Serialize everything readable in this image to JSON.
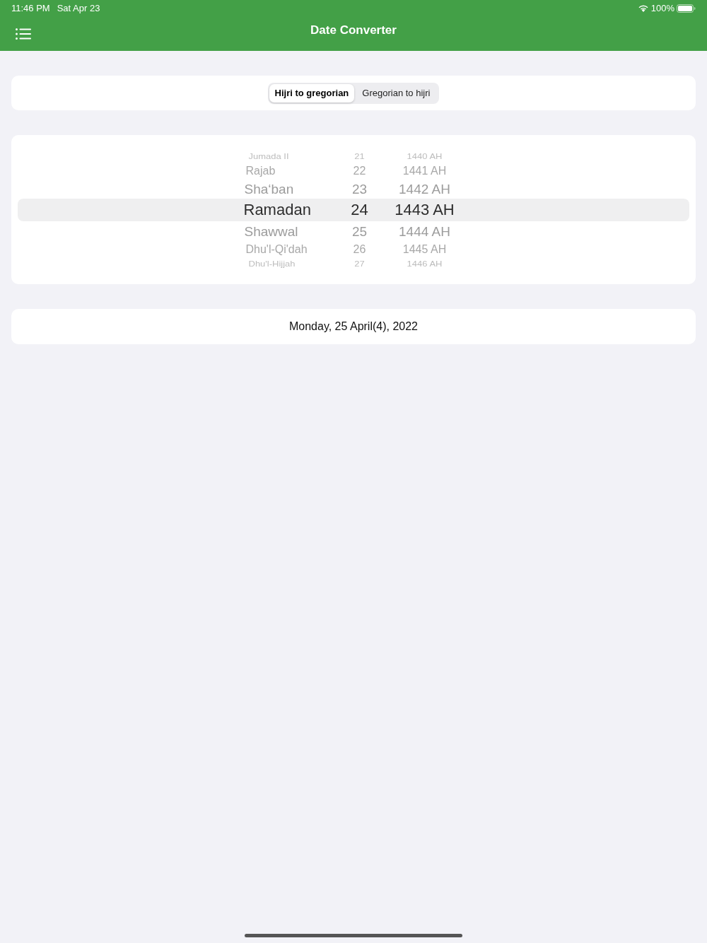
{
  "status_bar": {
    "time": "11:46 PM",
    "date": "Sat Apr 23",
    "battery": "100%"
  },
  "nav_bar": {
    "title": "Date Converter"
  },
  "mode_switch": {
    "segments": [
      {
        "label": "Hijri to gregorian",
        "selected": true
      },
      {
        "label": "Gregorian to hijri",
        "selected": false
      }
    ]
  },
  "date_picker": {
    "columns": [
      {
        "items": [
          {
            "text": "Jumada II",
            "selected": false
          },
          {
            "text": "Rajab",
            "selected": false
          },
          {
            "text": "Sha‘ban",
            "selected": false
          },
          {
            "text": "Ramadan",
            "selected": true
          },
          {
            "text": "Shawwal",
            "selected": false
          },
          {
            "text": "Dhu'l-Qi'dah",
            "selected": false
          },
          {
            "text": "Dhu'l-Hijjah",
            "selected": false
          }
        ]
      },
      {
        "items": [
          {
            "text": "21",
            "selected": false
          },
          {
            "text": "22",
            "selected": false
          },
          {
            "text": "23",
            "selected": false
          },
          {
            "text": "24",
            "selected": true
          },
          {
            "text": "25",
            "selected": false
          },
          {
            "text": "26",
            "selected": false
          },
          {
            "text": "27",
            "selected": false
          }
        ]
      },
      {
        "items": [
          {
            "text": "1440 AH",
            "selected": false
          },
          {
            "text": "1441 AH",
            "selected": false
          },
          {
            "text": "1442 AH",
            "selected": false
          },
          {
            "text": "1443 AH",
            "selected": true
          },
          {
            "text": "1444 AH",
            "selected": false
          },
          {
            "text": "1445 AH",
            "selected": false
          },
          {
            "text": "1446 AH",
            "selected": false
          }
        ]
      }
    ]
  },
  "result": {
    "text": "Monday, 25 April(4), 2022"
  }
}
